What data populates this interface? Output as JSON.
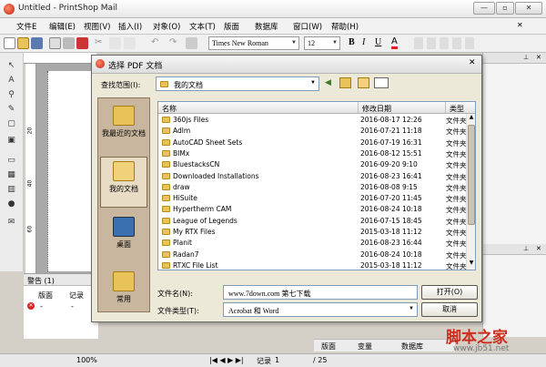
{
  "app": {
    "title": "Untitled - PrintShop Mail"
  },
  "menu": [
    "文件E",
    "编辑(E)",
    "视图(V)",
    "插入(I)",
    "对象(O)",
    "文本(T)",
    "版面",
    "数据库",
    "窗口(W)",
    "帮助(H)"
  ],
  "toolbar": {
    "font": "Times New Roman",
    "size": "12"
  },
  "canvas": {
    "ruler_marks": [
      "20",
      "40",
      "60"
    ]
  },
  "warnings": {
    "title": "警告 (1)",
    "cols": [
      "版面",
      "记录"
    ],
    "row": [
      "-",
      "-"
    ]
  },
  "statusbar": {
    "zoom": "100%",
    "record_label": "记录",
    "record_value": "1",
    "total": "/ 25"
  },
  "rpanel_tabs": [
    "版面",
    "变量",
    "数据库"
  ],
  "dialog": {
    "title": "选择 PDF 文档",
    "lookin_label": "查找范围(I):",
    "lookin_value": "我的文档",
    "places": [
      "我最近的文档",
      "我的文档",
      "桌面",
      "常用"
    ],
    "columns": [
      "名称",
      "修改日期",
      "类型"
    ],
    "files": [
      {
        "name": "360js Files",
        "date": "2016-08-17 12:26",
        "type": "文件夹"
      },
      {
        "name": "Adlm",
        "date": "2016-07-21 11:18",
        "type": "文件夹"
      },
      {
        "name": "AutoCAD Sheet Sets",
        "date": "2016-07-19 16:31",
        "type": "文件夹"
      },
      {
        "name": "BIMx",
        "date": "2016-08-12 15:51",
        "type": "文件夹"
      },
      {
        "name": "BluestacksCN",
        "date": "2016-09-20 9:10",
        "type": "文件夹"
      },
      {
        "name": "Downloaded Installations",
        "date": "2016-08-23 16:41",
        "type": "文件夹"
      },
      {
        "name": "draw",
        "date": "2016-08-08 9:15",
        "type": "文件夹"
      },
      {
        "name": "HiSuite",
        "date": "2016-07-20 11:45",
        "type": "文件夹"
      },
      {
        "name": "Hypertherm CAM",
        "date": "2016-08-24 10:18",
        "type": "文件夹"
      },
      {
        "name": "League of Legends",
        "date": "2016-07-15 18:45",
        "type": "文件夹"
      },
      {
        "name": "My RTX Files",
        "date": "2015-03-18 11:12",
        "type": "文件夹"
      },
      {
        "name": "Planit",
        "date": "2016-08-23 16:44",
        "type": "文件夹"
      },
      {
        "name": "Radan7",
        "date": "2016-08-24 10:18",
        "type": "文件夹"
      },
      {
        "name": "RTXC File List",
        "date": "2015-03-18 11:12",
        "type": "文件夹"
      }
    ],
    "filename_label": "文件名(N):",
    "filename_value": "www.7down.com 第七下载",
    "filetype_label": "文件类型(T):",
    "filetype_value": "Acrobat 和 Word",
    "open_button": "打开(O)",
    "cancel_button": "取消"
  },
  "watermark": {
    "main": "脚本之家",
    "sub": "www.jb51.net"
  },
  "colors": {
    "folder": "#e8c35a",
    "accent": "#cc2e1e",
    "places_bg": "#c8b79e"
  }
}
